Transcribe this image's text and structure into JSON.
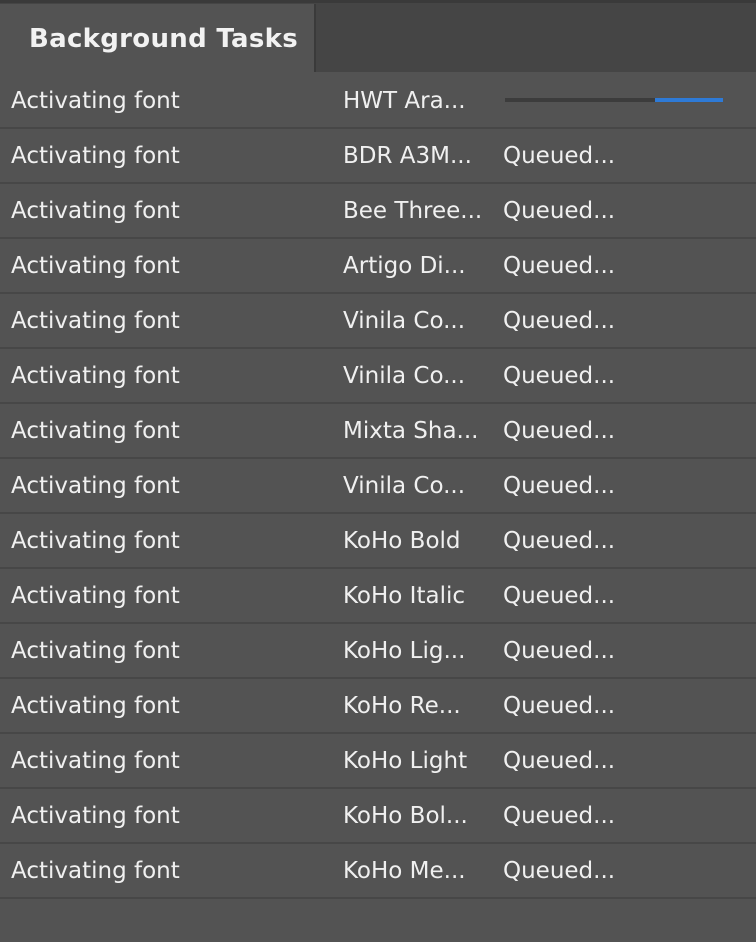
{
  "panel": {
    "tab_label": "Background Tasks"
  },
  "colors": {
    "panel_bg": "#535353",
    "tabbar_bg": "#454545",
    "row_divider": "#474747",
    "progress_accent": "#2e7ad6"
  },
  "tasks": [
    {
      "task": "Activating font",
      "font": "HWT Ara...",
      "status": "",
      "progress": {
        "start": 0.69,
        "end": 1.0
      }
    },
    {
      "task": "Activating font",
      "font": "BDR A3M...",
      "status": "Queued..."
    },
    {
      "task": "Activating font",
      "font": "Bee Three...",
      "status": "Queued..."
    },
    {
      "task": "Activating font",
      "font": "Artigo Di...",
      "status": "Queued..."
    },
    {
      "task": "Activating font",
      "font": "Vinila Co...",
      "status": "Queued..."
    },
    {
      "task": "Activating font",
      "font": "Vinila Co...",
      "status": "Queued..."
    },
    {
      "task": "Activating font",
      "font": "Mixta Sha...",
      "status": "Queued..."
    },
    {
      "task": "Activating font",
      "font": "Vinila Co...",
      "status": "Queued..."
    },
    {
      "task": "Activating font",
      "font": "KoHo Bold",
      "status": "Queued..."
    },
    {
      "task": "Activating font",
      "font": "KoHo Italic",
      "status": "Queued..."
    },
    {
      "task": "Activating font",
      "font": "KoHo Lig...",
      "status": "Queued..."
    },
    {
      "task": "Activating font",
      "font": "KoHo Re...",
      "status": "Queued..."
    },
    {
      "task": "Activating font",
      "font": "KoHo Light",
      "status": "Queued..."
    },
    {
      "task": "Activating font",
      "font": "KoHo Bol...",
      "status": "Queued..."
    },
    {
      "task": "Activating font",
      "font": "KoHo Me...",
      "status": "Queued..."
    }
  ]
}
